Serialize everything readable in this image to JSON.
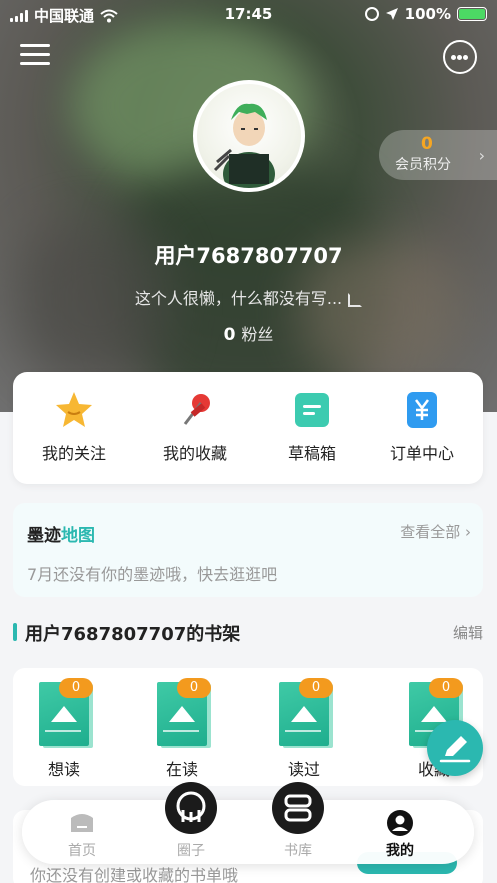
{
  "status_bar": {
    "carrier": "中国联通",
    "time": "17:45",
    "battery": "100%"
  },
  "profile": {
    "username": "用户7687807707",
    "bio": "这个人很懒，什么都没有写...",
    "fans_count": "0",
    "fans_label": "粉丝",
    "points_value": "0",
    "points_label": "会员积分"
  },
  "quick_actions": [
    {
      "label": "我的关注",
      "icon": "star-icon"
    },
    {
      "label": "我的收藏",
      "icon": "pin-icon"
    },
    {
      "label": "草稿箱",
      "icon": "drafts-icon"
    },
    {
      "label": "订单中心",
      "icon": "yen-icon"
    }
  ],
  "map": {
    "title_prefix": "墨迹",
    "title_accent": "地图",
    "view_all": "查看全部",
    "empty_text": "7月还没有你的墨迹哦，快去逛逛吧"
  },
  "bookshelf": {
    "title": "用户7687807707的书架",
    "edit": "编辑",
    "items": [
      {
        "label": "想读",
        "count": "0"
      },
      {
        "label": "在读",
        "count": "0"
      },
      {
        "label": "读过",
        "count": "0"
      },
      {
        "label": "收藏",
        "count": "0"
      }
    ]
  },
  "booklist": {
    "empty_text": "你还没有创建或收藏的书单哦"
  },
  "tabbar": {
    "items": [
      {
        "label": "首页"
      },
      {
        "label": "圈子"
      },
      {
        "label": "书库"
      },
      {
        "label": "我的"
      }
    ],
    "active": "我的"
  },
  "colors": {
    "accent": "#2bb8b0",
    "badge": "#f39a1e",
    "points": "#f5a623"
  }
}
